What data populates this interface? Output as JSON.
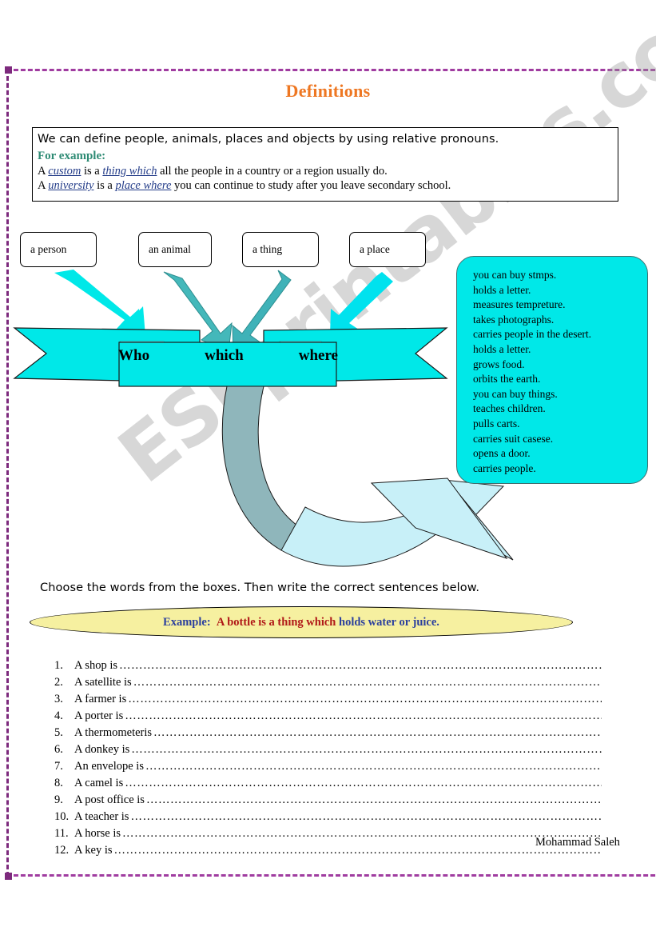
{
  "title": "Definitions",
  "intro": {
    "line1": "We can define people, animals, places and objects by using relative pronouns.",
    "for_example_label": "For example:",
    "example1_pre": "A ",
    "example1_kw1": "custom",
    "example1_mid": " is a ",
    "example1_kw2": "thing which",
    "example1_post": " all the people in a country or a region usually do.",
    "example2_pre": "A ",
    "example2_kw1": "university",
    "example2_mid": " is a ",
    "example2_kw2": "place where",
    "example2_post": " you can continue to study after you leave secondary school."
  },
  "categories": [
    {
      "label": "a person"
    },
    {
      "label": "an animal"
    },
    {
      "label": "a thing"
    },
    {
      "label": "a place"
    }
  ],
  "banner": {
    "words": [
      "Who",
      "which",
      "where"
    ]
  },
  "phrase_box": {
    "items": [
      "you can buy stmps.",
      "holds a letter.",
      "measures tempreture.",
      "takes photographs.",
      "carries people in the desert.",
      "holds a letter.",
      "grows food.",
      "orbits the earth.",
      "you can buy things.",
      "teaches children.",
      "pulls carts.",
      "carries suit casese.",
      "opens a door.",
      "carries people."
    ]
  },
  "instruction": "Choose the words from the boxes. Then write the correct sentences below.",
  "example_sentence": {
    "label": "Example:",
    "red_part": "A bottle is a thing which",
    "blue_part": "holds water or juice."
  },
  "exercises": [
    {
      "num": "1.",
      "text": "A shop is"
    },
    {
      "num": "2.",
      "text": "A satellite is"
    },
    {
      "num": "3.",
      "text": "A farmer is"
    },
    {
      "num": "4.",
      "text": "A porter is"
    },
    {
      "num": "5.",
      "text": "A thermometeris"
    },
    {
      "num": "6.",
      "text": "A donkey is"
    },
    {
      "num": "7.",
      "text": "An envelope is"
    },
    {
      "num": "8.",
      "text": "A camel is"
    },
    {
      "num": "9.",
      "text": "A post office is"
    },
    {
      "num": "10.",
      "text": "A teacher is"
    },
    {
      "num": "11.",
      "text": "A horse is"
    },
    {
      "num": "12.",
      "text": "A key is"
    }
  ],
  "dots": "……………………………………………………………………………………………………………………………………………………",
  "author": "Mohammad Saleh",
  "watermark": "ESLprintables.com",
  "colors": {
    "title_orange": "#ee7722",
    "for_example_green": "#2e8b74",
    "keyword_blue": "#223b88",
    "cyan": "#00e8e8",
    "teal_arrow": "#3fb5b5",
    "light_arrow": "#c8f0f8",
    "yellow_ellipse": "#f6f0a0",
    "example_blue": "#2b3f9e",
    "example_red": "#b01818",
    "border_purple": "#7d2a7d"
  }
}
